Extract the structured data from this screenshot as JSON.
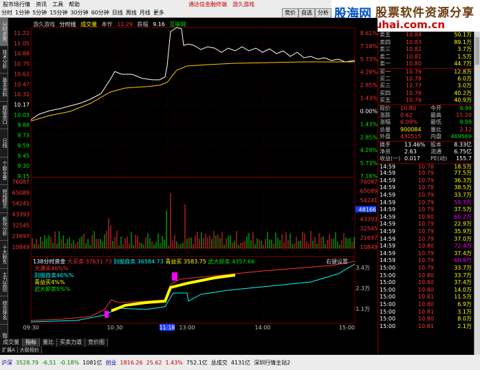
{
  "menubar": {
    "items": [
      "股市场行情",
      "资讯",
      "工具",
      "帮助"
    ],
    "notice": "通达信金融终端",
    "stock_title": "游久游戏"
  },
  "periodbar": {
    "items": [
      "分时",
      "1分钟",
      "5分钟",
      "15分钟",
      "30分钟",
      "60分钟",
      "日线",
      "周线",
      "月线",
      "更多"
    ]
  },
  "right_toolbar": {
    "items": [
      "竞价",
      "自选",
      "分析"
    ]
  },
  "watermark": {
    "logo": "股海网",
    "slogan": "股票软件资源分享",
    "url": "www.Guhai.com.cn"
  },
  "left_tabs": [
    "分时走势",
    "技术分析",
    "基本资料",
    "超级盘口",
    "日线",
    "个股全景",
    "短线精灵",
    "板块分析",
    "十大股东",
    "主力监控",
    "综合排名",
    "指标"
  ],
  "chart": {
    "header": {
      "name": "游久游戏",
      "period": "分时线",
      "vol_label": "成交量",
      "avg_label": "本作",
      "price_label": "11.29",
      "change_label": "跌幅",
      "change_value": "9.16",
      "mode": "互联网"
    },
    "price_ticks": [
      "11.22",
      "11.05",
      "10.88",
      "10.75",
      "10.62",
      "10.47",
      "10.32",
      "10.17",
      "10.03",
      "9.88",
      "9.73",
      "9.59",
      "9.45",
      "9.30",
      "9.15"
    ],
    "pct_ticks": [
      "8.61%",
      "7.18%",
      "5.73%",
      "4.29%",
      "2.85%",
      "1.43%",
      "0.00%",
      "1.43%",
      "2.85%",
      "4.29%",
      "5.73%",
      "7.18%"
    ],
    "vol_ticks": [
      "76087",
      "65089",
      "54241",
      "43393",
      "32545",
      "21697",
      "10849"
    ],
    "vol_ticks_right": [
      "76087",
      "65089",
      "54241",
      "48166",
      "43393",
      "32545",
      "21697",
      "10849"
    ],
    "vol_highlight": "48166",
    "bs_header": {
      "title": "138分时资金",
      "big_buy_label": "大买卖",
      "big_buy_value": "37631.73",
      "big_sell_label": "别抛自卖",
      "big_sell_value": "36584.73",
      "mid_label": "青益买",
      "mid_value": "3583.75",
      "small_label": "武大卸卖",
      "small_value": "4357.66"
    },
    "bs_settings": "右键设置",
    "bs_legend": [
      "大满买46%%",
      "别抛自卖46%%",
      "青益买4%%",
      "武大卸卖5%%"
    ],
    "bs_ticks_right": [
      "3.4万",
      "2.3万",
      "1.1万"
    ],
    "time_labels": [
      "09:30",
      "10:30",
      "11:18",
      "13:00",
      "14:00",
      "15:00"
    ],
    "time_highlight": "11:18",
    "bottom_tabs": [
      "成交量",
      "指标",
      "量比",
      "买卖力道",
      "竞价图"
    ],
    "bottom_tabs2": [
      "扩展A",
      "大联相价"
    ]
  },
  "quote": {
    "sells": [
      {
        "label": "卖五",
        "price": "10.84",
        "vol": "50.1万"
      },
      {
        "label": "卖四",
        "price": "10.83",
        "vol": "89.1万"
      },
      {
        "label": "卖三",
        "price": "10.82",
        "vol": "3.7万"
      },
      {
        "label": "卖二",
        "price": "10.81",
        "vol": "1.5万"
      },
      {
        "label": "卖一",
        "price": "10.80",
        "vol": "44.7万"
      }
    ],
    "buys": [
      {
        "label": "买一",
        "price": "10.79",
        "vol": "12.8万"
      },
      {
        "label": "买二",
        "price": "10.78",
        "vol": "6.0万"
      },
      {
        "label": "买三",
        "price": "10.77",
        "vol": "3.0万"
      },
      {
        "label": "买四",
        "price": "10.76",
        "vol": "40.2万"
      },
      {
        "label": "买五",
        "price": "10.76",
        "vol": "40.9万"
      }
    ],
    "stats": [
      {
        "l1": "现价",
        "v1": "10.80",
        "l2": "今开",
        "v2": "9.99",
        "c1": "red",
        "c2": "green"
      },
      {
        "l1": "涨跌",
        "v1": "0.62",
        "l2": "最高",
        "v2": "11.20",
        "c1": "red",
        "c2": "red"
      },
      {
        "l1": "涨幅",
        "v1": "6.09%",
        "l2": "最低",
        "v2": "9.99",
        "c1": "red",
        "c2": "green"
      },
      {
        "l1": "总量",
        "v1": "900084",
        "l2": "量比",
        "v2": "2.12",
        "c1": "yellow",
        "c2": "red"
      },
      {
        "l1": "外盘",
        "v1": "430515",
        "l2": "内盘",
        "v2": "469569",
        "c1": "red",
        "c2": "green"
      }
    ],
    "stats2": [
      {
        "l1": "换手",
        "v1": "13.46%",
        "l2": "股本",
        "v2": "8.33亿"
      },
      {
        "l1": "净资",
        "v1": "2.63",
        "l2": "流通",
        "v2": "6.75亿"
      },
      {
        "l1": "收益(一)",
        "v1": "0.017",
        "l2": "PE(动)",
        "v2": "155.7"
      }
    ],
    "ticks": [
      {
        "t": "14:59",
        "p": "10.78",
        "v": "18.5万",
        "pc": "red",
        "vc": "yellow"
      },
      {
        "t": "14:59",
        "p": "10.79",
        "v": "77.5万",
        "pc": "red",
        "vc": "yellow"
      },
      {
        "t": "14:59",
        "p": "10.79",
        "v": "36.3万",
        "pc": "red",
        "vc": "yellow"
      },
      {
        "t": "14:59",
        "p": "10.78",
        "v": "38.5万",
        "pc": "red",
        "vc": "yellow"
      },
      {
        "t": "14:59",
        "p": "10.79",
        "v": "33.7万",
        "pc": "red",
        "vc": "yellow"
      },
      {
        "t": "14:59",
        "p": "10.79",
        "v": "59.7万",
        "pc": "red",
        "vc": "magenta"
      },
      {
        "t": "14:59",
        "p": "10.79",
        "v": "37.5万",
        "pc": "red",
        "vc": "yellow"
      },
      {
        "t": "14:59",
        "p": "10.80",
        "v": "60.2万",
        "pc": "red",
        "vc": "magenta"
      },
      {
        "t": "14:59",
        "p": "10.79",
        "v": "22.9万",
        "pc": "red",
        "vc": "yellow"
      },
      {
        "t": "14:59",
        "p": "10.79",
        "v": "35.9万",
        "pc": "red",
        "vc": "yellow"
      },
      {
        "t": "14:59",
        "p": "10.79",
        "v": "37.0万",
        "pc": "red",
        "vc": "yellow"
      },
      {
        "t": "14:59",
        "p": "10.80",
        "v": "72.4万",
        "pc": "red",
        "vc": "magenta"
      },
      {
        "t": "14:59",
        "p": "10.79",
        "v": "37.4万",
        "pc": "red",
        "vc": "yellow"
      },
      {
        "t": "14:59",
        "p": "10.79",
        "v": "60.9万",
        "pc": "red",
        "vc": "magenta"
      },
      {
        "t": "15:00",
        "p": "10.79",
        "v": "33.7万",
        "pc": "red",
        "vc": "yellow"
      },
      {
        "t": "15:00",
        "p": "10.80",
        "v": "33.7万",
        "pc": "red",
        "vc": "yellow"
      },
      {
        "t": "15:00",
        "p": "10.80",
        "v": "37.4万",
        "pc": "red",
        "vc": "yellow"
      },
      {
        "t": "15:00",
        "p": "10.80",
        "v": "14.0万",
        "pc": "red",
        "vc": "yellow"
      },
      {
        "t": "15:00",
        "p": "10.81",
        "v": "11.5万",
        "pc": "red",
        "vc": "yellow"
      },
      {
        "t": "15:00",
        "p": "10.80",
        "v": "6.9万",
        "pc": "red",
        "vc": "yellow"
      },
      {
        "t": "15:00",
        "p": "10.81",
        "v": "3.1万",
        "pc": "red",
        "vc": "yellow"
      },
      {
        "t": "15:00",
        "p": "10.80",
        "v": "8.0万",
        "pc": "red",
        "vc": "yellow"
      },
      {
        "t": "15:00",
        "p": "10.81",
        "v": "2.1万",
        "pc": "red",
        "vc": "yellow"
      }
    ]
  },
  "statusbar": {
    "idx1_name": "沪深",
    "idx1_value": "3528.79",
    "idx1_chg": "-6.51",
    "idx1_pct": "-0.18%",
    "idx1_amt": "1081亿",
    "idx2_name": "创业",
    "idx2_value": "1816.26",
    "idx2_chg": "25.62",
    "idx2_pct": "1.43%",
    "idx2_amt": "752.1亿",
    "total_label": "总成交",
    "total_amt": "4131亿",
    "server": "深圳行情主站2"
  }
}
